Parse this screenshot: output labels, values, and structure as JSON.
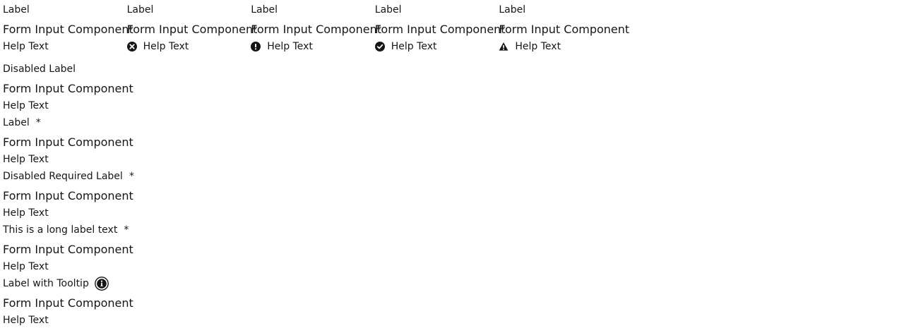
{
  "top_row": [
    {
      "label": "Label",
      "input": "Form Input Component",
      "help": "Help Text",
      "status_icon": ""
    },
    {
      "label": "Label",
      "input": "Form Input Component",
      "help": "Help Text",
      "status_icon": "error-circle-icon"
    },
    {
      "label": "Label",
      "input": "Form Input Component",
      "help": "Help Text",
      "status_icon": "exclamation-circle-icon"
    },
    {
      "label": "Label",
      "input": "Form Input Component",
      "help": "Help Text",
      "status_icon": "check-circle-icon"
    },
    {
      "label": "Label",
      "input": "Form Input Component",
      "help": "Help Text",
      "status_icon": "warning-triangle-icon"
    }
  ],
  "disabled": {
    "label": "Disabled Label",
    "input": "Form Input Component",
    "help": "Help Text"
  },
  "required": {
    "label": "Label",
    "required_mark": "*",
    "input": "Form Input Component",
    "help": "Help Text"
  },
  "disabled_required": {
    "label": "Disabled Required Label",
    "required_mark": "*",
    "input": "Form Input Component",
    "help": "Help Text"
  },
  "long_label": {
    "label": "This is a long label text",
    "required_mark": "*",
    "input": "Form Input Component",
    "help": "Help Text"
  },
  "tooltip": {
    "label": "Label with Tooltip",
    "tooltip_icon": "info-circle-icon",
    "input": "Form Input Component",
    "help": "Help Text"
  }
}
